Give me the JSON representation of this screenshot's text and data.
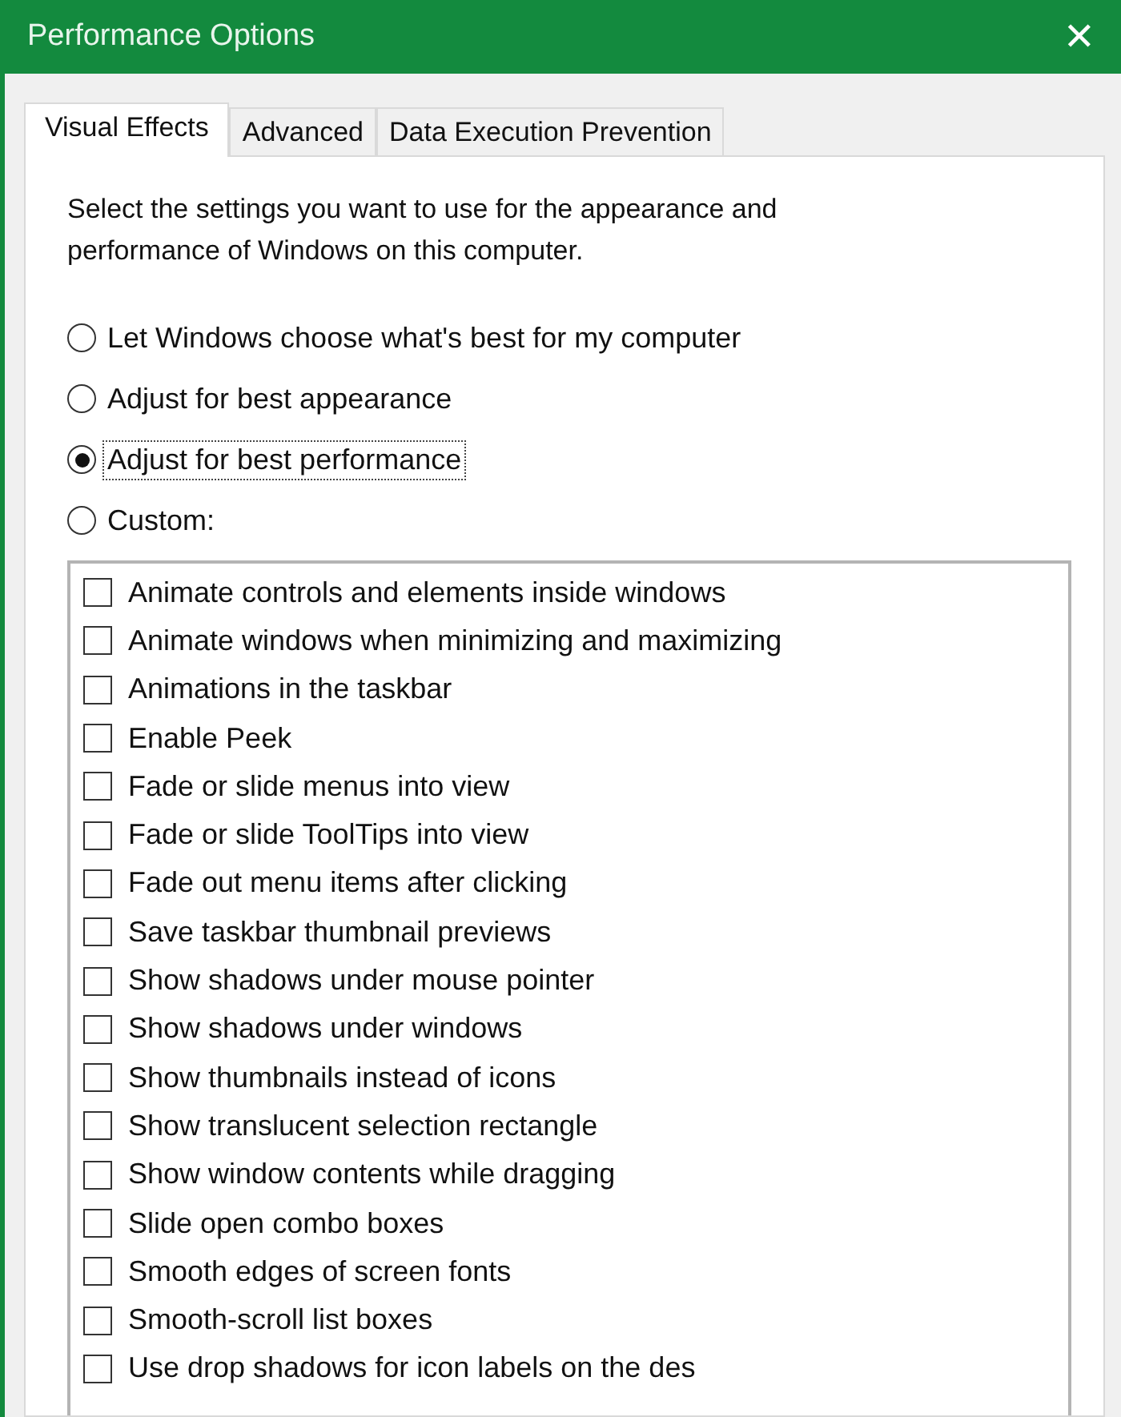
{
  "window": {
    "title": "Performance Options",
    "close": "✕"
  },
  "tabs": [
    {
      "label": "Visual Effects",
      "selected": true
    },
    {
      "label": "Advanced",
      "selected": false
    },
    {
      "label": "Data Execution Prevention",
      "selected": false
    }
  ],
  "description": "Select the settings you want to use for the appearance and performance of Windows on this computer.",
  "options": [
    {
      "label": "Let Windows choose what's best for my computer",
      "selected": false
    },
    {
      "label": "Adjust for best appearance",
      "selected": false
    },
    {
      "label": "Adjust for best performance",
      "selected": true
    },
    {
      "label": "Custom:",
      "selected": false
    }
  ],
  "settings": [
    {
      "label": "Animate controls and elements inside windows",
      "checked": false
    },
    {
      "label": "Animate windows when minimizing and maximizing",
      "checked": false
    },
    {
      "label": "Animations in the taskbar",
      "checked": false
    },
    {
      "label": "Enable Peek",
      "checked": false
    },
    {
      "label": "Fade or slide menus into view",
      "checked": false
    },
    {
      "label": "Fade or slide ToolTips into view",
      "checked": false
    },
    {
      "label": "Fade out menu items after clicking",
      "checked": false
    },
    {
      "label": "Save taskbar thumbnail previews",
      "checked": false
    },
    {
      "label": "Show shadows under mouse pointer",
      "checked": false
    },
    {
      "label": "Show shadows under windows",
      "checked": false
    },
    {
      "label": "Show thumbnails instead of icons",
      "checked": false
    },
    {
      "label": "Show translucent selection rectangle",
      "checked": false
    },
    {
      "label": "Show window contents while dragging",
      "checked": false
    },
    {
      "label": "Slide open combo boxes",
      "checked": false
    },
    {
      "label": "Smooth edges of screen fonts",
      "checked": false
    },
    {
      "label": "Smooth-scroll list boxes",
      "checked": false
    },
    {
      "label": "Use drop shadows for icon labels on the des",
      "checked": false
    }
  ]
}
